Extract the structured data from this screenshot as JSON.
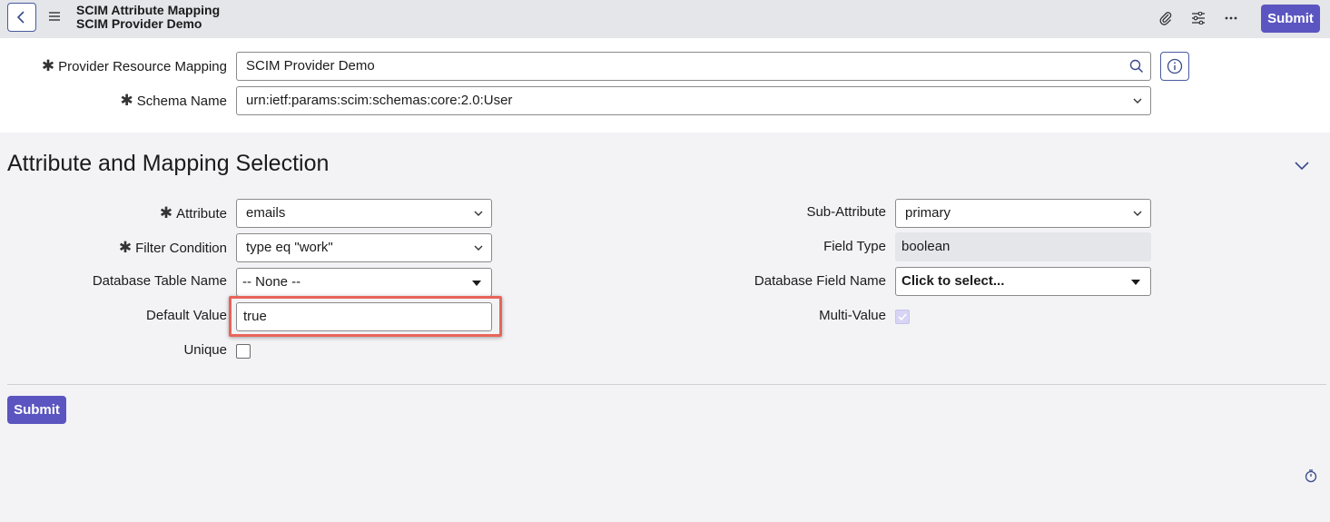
{
  "header": {
    "title": "SCIM Attribute Mapping",
    "subtitle": "SCIM Provider Demo",
    "submit_label": "Submit",
    "icons": [
      "back-icon",
      "menu-icon",
      "attachment-icon",
      "settings-sliders-icon",
      "more-icon"
    ]
  },
  "provider_mapping": {
    "label": "Provider Resource Mapping",
    "value": "SCIM Provider Demo",
    "required": true
  },
  "schema_name": {
    "label": "Schema Name",
    "value": "urn:ietf:params:scim:schemas:core:2.0:User",
    "required": true
  },
  "section": {
    "title": "Attribute and Mapping Selection"
  },
  "left_fields": {
    "attribute": {
      "label": "Attribute",
      "value": "emails",
      "required": true
    },
    "filter_condition": {
      "label": "Filter Condition",
      "value": "type eq \"work\"",
      "required": true
    },
    "database_table_name": {
      "label": "Database Table Name",
      "value": "-- None --"
    },
    "default_value": {
      "label": "Default Value",
      "value": "true"
    },
    "unique": {
      "label": "Unique",
      "checked": false
    }
  },
  "right_fields": {
    "sub_attribute": {
      "label": "Sub-Attribute",
      "value": "primary"
    },
    "field_type": {
      "label": "Field Type",
      "value": "boolean"
    },
    "database_field_name": {
      "label": "Database Field Name",
      "value": "Click to select..."
    },
    "multi_value": {
      "label": "Multi-Value",
      "checked": true,
      "disabled": true
    }
  },
  "footer": {
    "submit_label": "Submit"
  },
  "colors": {
    "primary": "#5b55c1",
    "highlight": "#e8645a",
    "header_bg": "#e4e6ea"
  }
}
